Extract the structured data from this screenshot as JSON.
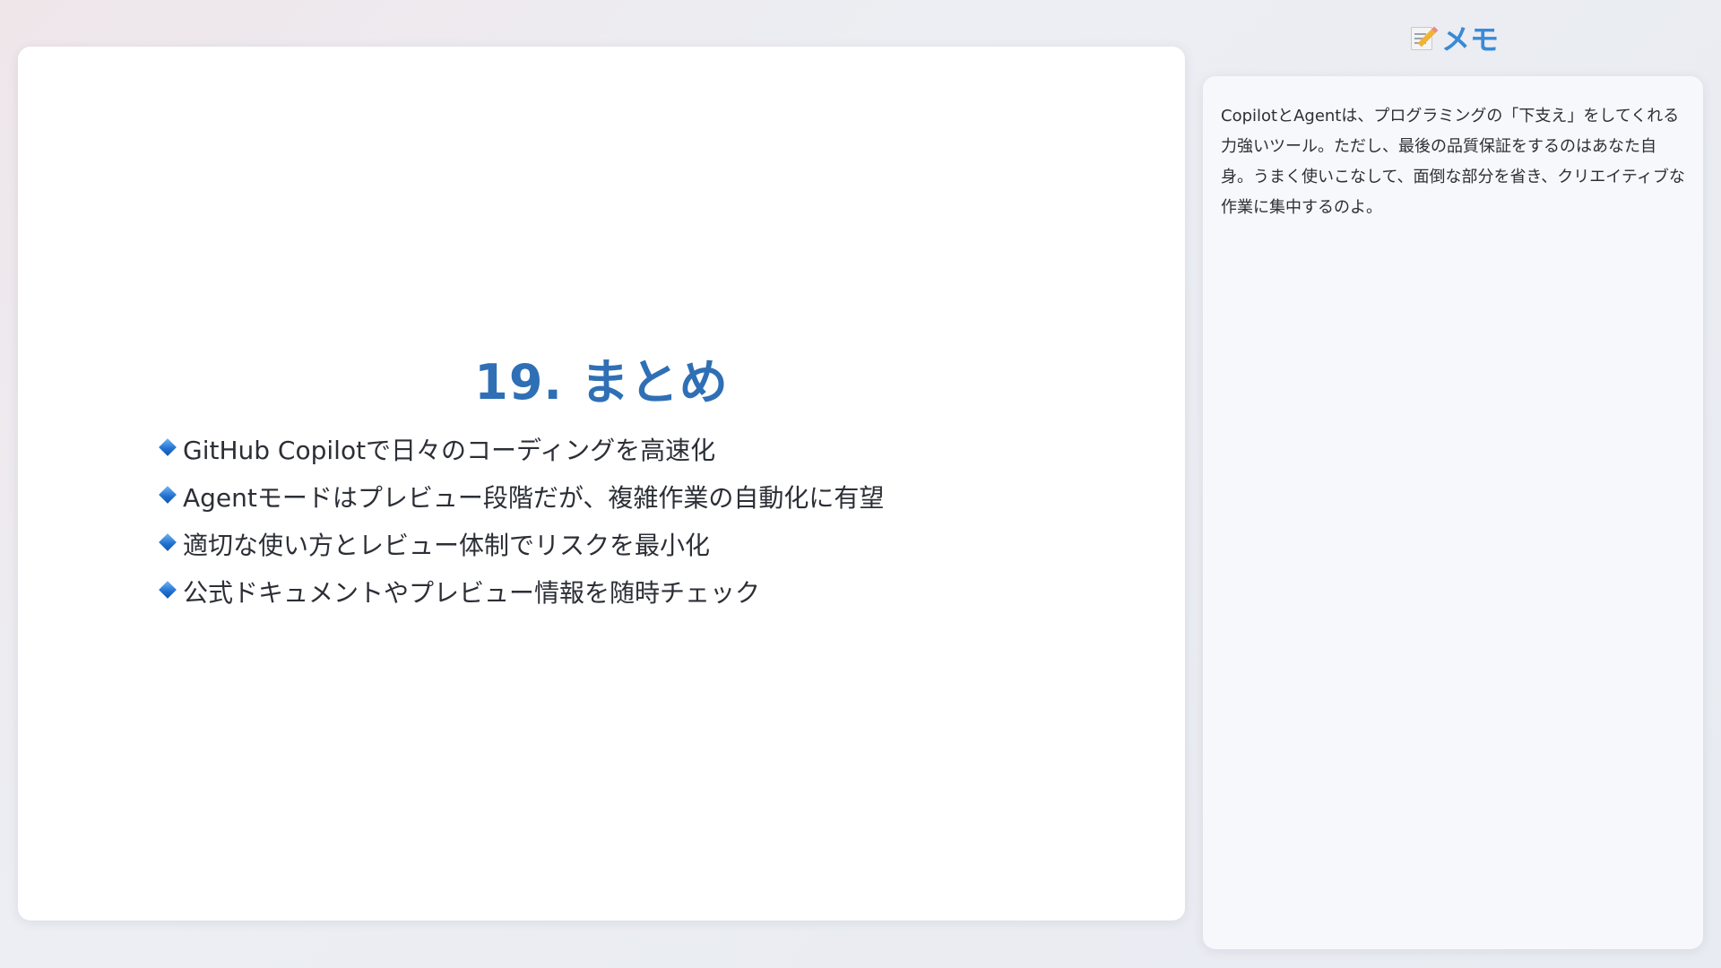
{
  "colors": {
    "accent": "#2f6fb5",
    "memo_title": "#3a8ad6",
    "text": "#2c2f36"
  },
  "slide": {
    "title": "19. まとめ",
    "bullet_icon": "large-blue-diamond-icon",
    "bullets": [
      "GitHub Copilotで日々のコーディングを高速化",
      "Agentモードはプレビュー段階だが、複雑作業の自動化に有望",
      "適切な使い方とレビュー体制でリスクを最小化",
      "公式ドキュメントやプレビュー情報を随時チェック"
    ]
  },
  "memo": {
    "icon": "memo-icon",
    "title": "メモ",
    "text": "CopilotとAgentは、プログラミングの「下支え」をしてくれる力強いツール。ただし、最後の品質保証をするのはあなた自身。うまく使いこなして、面倒な部分を省き、クリエイティブな作業に集中するのよ。"
  }
}
